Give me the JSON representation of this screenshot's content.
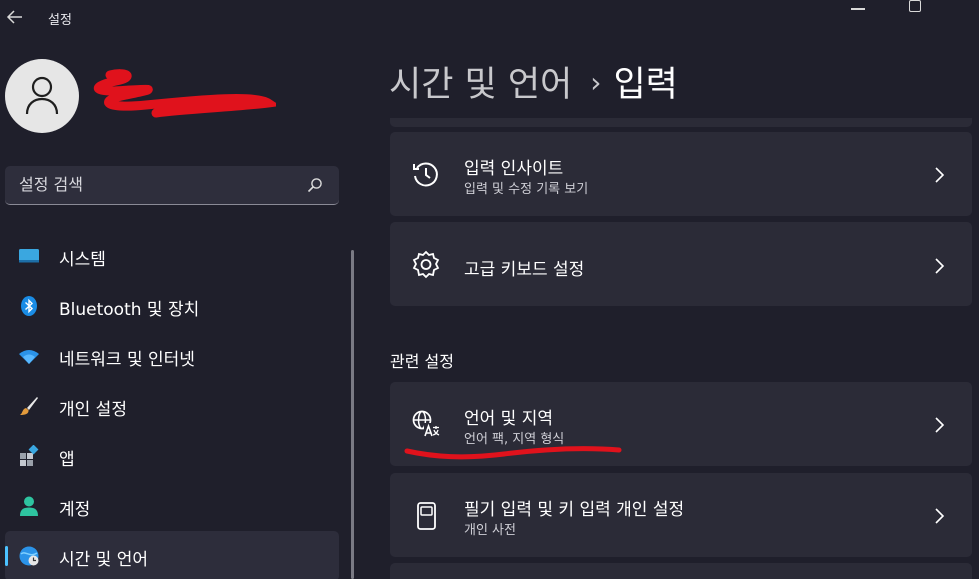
{
  "app": {
    "title": "설정"
  },
  "search": {
    "placeholder": "설정 검색"
  },
  "nav": [
    {
      "label": "시스템",
      "icon": "monitor-icon"
    },
    {
      "label": "Bluetooth 및 장치",
      "icon": "bluetooth-icon"
    },
    {
      "label": "네트워크 및 인터넷",
      "icon": "wifi-icon"
    },
    {
      "label": "개인 설정",
      "icon": "brush-icon"
    },
    {
      "label": "앱",
      "icon": "apps-icon"
    },
    {
      "label": "계정",
      "icon": "person-icon"
    },
    {
      "label": "시간 및 언어",
      "icon": "globe-clock-icon",
      "active": true
    }
  ],
  "breadcrumb": {
    "parent": "시간 및 언어",
    "separator": "›",
    "current": "입력"
  },
  "cards": [
    {
      "title": "입력 인사이트",
      "subtitle": "입력 및 수정 기록 보기",
      "icon": "history-icon"
    },
    {
      "title": "고급 키보드 설정",
      "subtitle": "",
      "icon": "gear-icon"
    }
  ],
  "related": {
    "section_title": "관련 설정",
    "cards": [
      {
        "title": "언어 및 지역",
        "subtitle": "언어 팩, 지역 형식",
        "icon": "language-icon"
      },
      {
        "title": "필기 입력 및 키 입력 개인 설정",
        "subtitle": "개인 사전",
        "icon": "notebook-icon"
      }
    ]
  },
  "colors": {
    "background": "#1f1f2b",
    "card": "#2b2b37",
    "accent": "#4cc2ff",
    "redaction": "#e0121c"
  }
}
